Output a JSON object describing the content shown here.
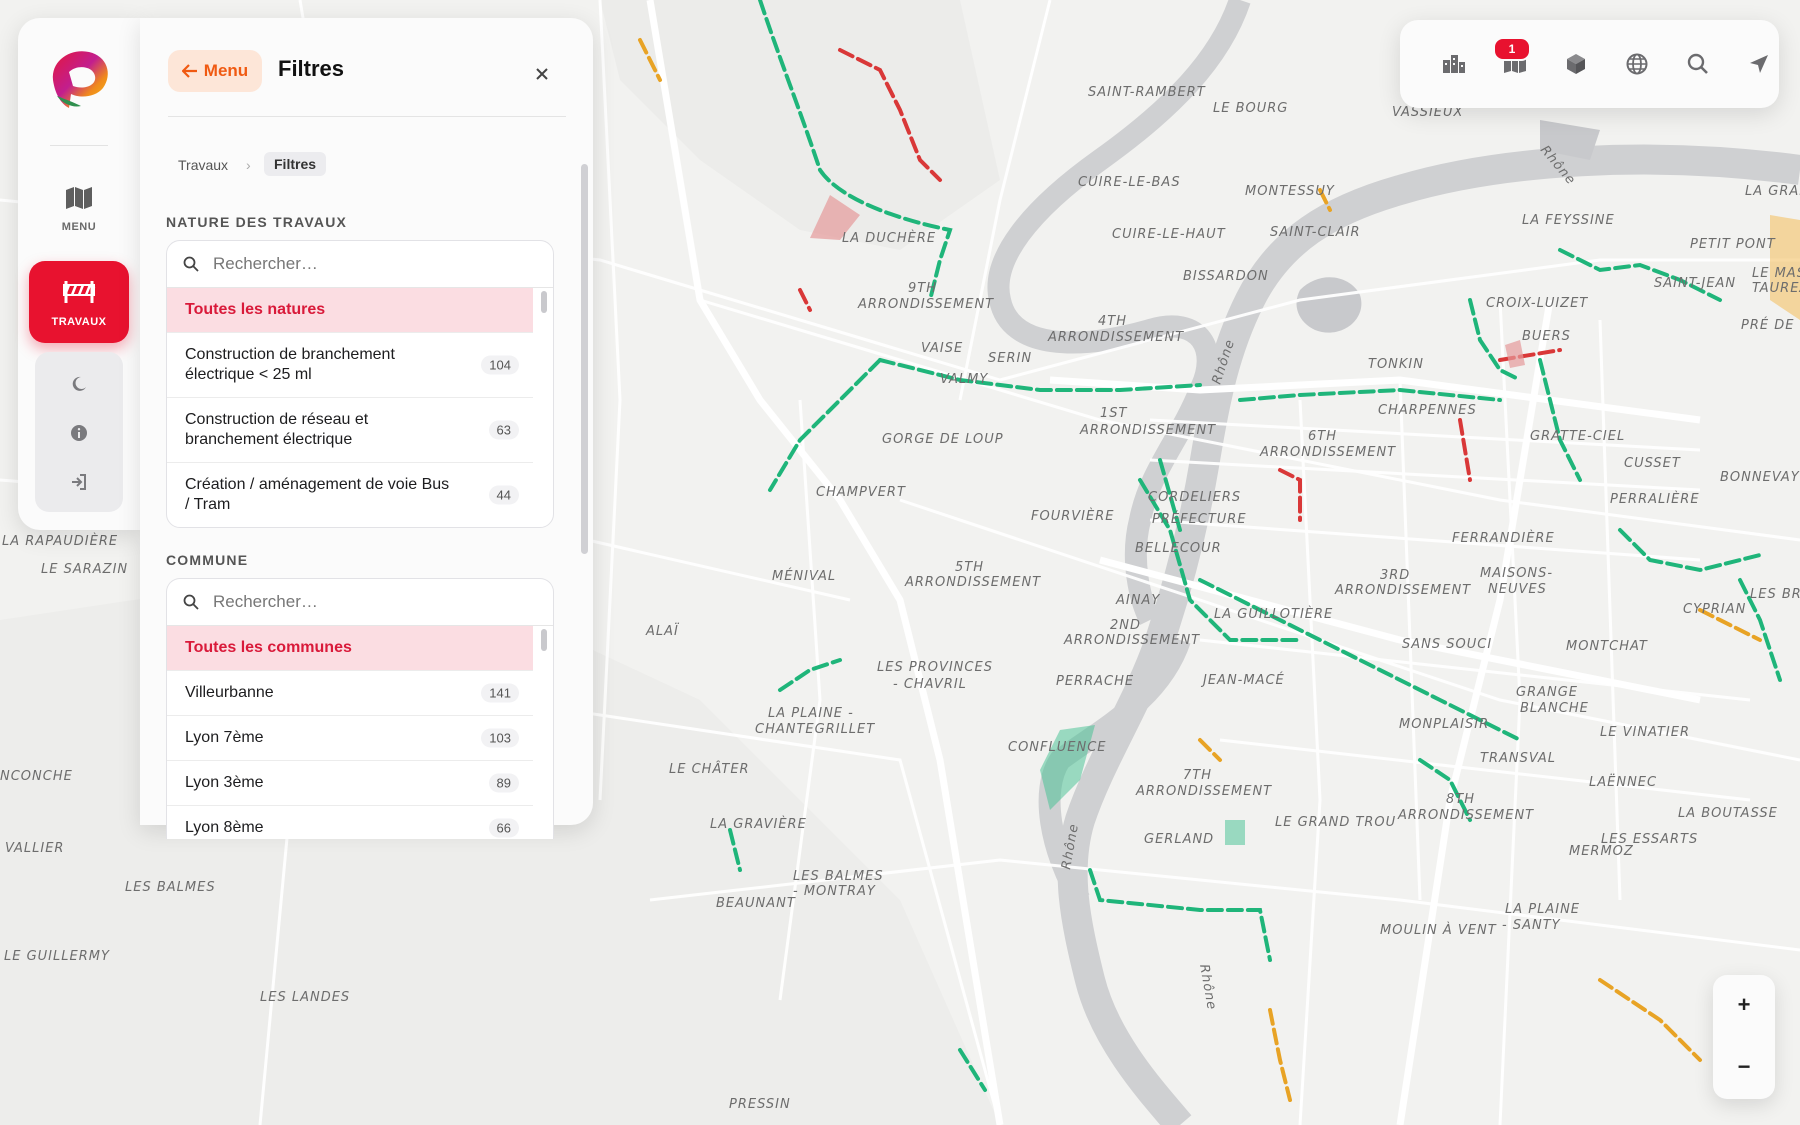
{
  "rail": {
    "menu_label": "MENU",
    "travaux_label": "TRAVAUX",
    "icons": {
      "menu": "map-icon",
      "travaux": "roadworks-barrier-icon",
      "theme": "moon-icon",
      "info": "info-icon",
      "login": "login-icon"
    }
  },
  "panel": {
    "back_label": "Menu",
    "title": "Filtres",
    "breadcrumb": [
      "Travaux",
      "Filtres"
    ],
    "nature": {
      "heading": "NATURE DES TRAVAUX",
      "search_placeholder": "Rechercher…",
      "selected": "Toutes les natures",
      "items": [
        {
          "label": "Construction de branchement électrique < 25 ml",
          "count": "104"
        },
        {
          "label": "Construction de réseau et branchement électrique",
          "count": "63"
        },
        {
          "label": "Création / aménagement de voie Bus / Tram",
          "count": "44"
        }
      ]
    },
    "commune": {
      "heading": "COMMUNE",
      "search_placeholder": "Rechercher…",
      "selected": "Toutes les communes",
      "items": [
        {
          "label": "Villeurbanne",
          "count": "141"
        },
        {
          "label": "Lyon 7ème",
          "count": "103"
        },
        {
          "label": "Lyon 3ème",
          "count": "89"
        },
        {
          "label": "Lyon 8ème",
          "count": "66"
        }
      ]
    }
  },
  "toolbar": {
    "badge": "1",
    "icons": [
      "buildings-icon",
      "map-layers-icon",
      "cube-3d-icon",
      "globe-icon",
      "search-icon",
      "locate-arrow-icon"
    ]
  },
  "zoom": {
    "in": "+",
    "out": "−"
  },
  "map": {
    "labels": [
      "SAINT-RAMBERT",
      "LE BOURG",
      "VASSIEUX",
      "CUIRE-LE-BAS",
      "MONTESSUY",
      "LA GRAF",
      "LA DUCHÈRE",
      "CUIRE-LE-HAUT",
      "SAINT-CLAIR",
      "LA FEYSSINE",
      "PETIT PONT",
      "9TH",
      "ARRONDISSEMENT",
      "BISSARDON",
      "CROIX-LUIZET",
      "SAINT-JEAN",
      "LE MAS DU",
      "TAUREAU",
      "4TH",
      "ARRONDISSEMENT",
      "BUERS",
      "PRÉ DE L",
      "VAISE",
      "SERIN",
      "TONKIN",
      "VALMY",
      "1ST",
      "ARRONDISSEMENT",
      "CHARPENNES",
      "GORGE DE LOUP",
      "6TH",
      "ARRONDISSEMENT",
      "GRATTE-CIEL",
      "CUSSET",
      "BONNEVAY",
      "CHAMPVERT",
      "CORDELIERS",
      "PERRALIÈRE",
      "FOURVIÈRE",
      "PRÉFECTURE",
      "FERRANDIÈRE",
      "BELLECOUR",
      "MÉNIVAL",
      "5TH",
      "ARRONDISSEMENT",
      "3RD",
      "ARRONDISSEMENT",
      "MAISONS-",
      "NEUVES",
      "AINAY",
      "CYPRIAN",
      "LES BRO",
      "ALAÏ",
      "2ND",
      "ARRONDISSEMENT",
      "LA GUILLOTIÈRE",
      "SANS SOUCI",
      "MONTCHAT",
      "LES PROVINCES",
      "- CHAVRIL",
      "PERRACHE",
      "JEAN-MACÉ",
      "GRANGE",
      "BLANCHE",
      "LA PLAINE -",
      "CHANTEGRILLET",
      "MONPLAISIR",
      "LE VINATIER",
      "CONFLUENCE",
      "TRANSVAL",
      "LE CHÂTER",
      "7TH",
      "ARRONDISSEMENT",
      "LAËNNEC",
      "8TH",
      "ARRONDISSEMENT",
      "LA BOUTASSE",
      "LA GRAVIÈRE",
      "GERLAND",
      "LE GRAND TROU",
      "MERMOZ",
      "LES ESSARTS",
      "LES BALMES",
      "- MONTRAY",
      "BEAUNANT",
      "MOULIN À VENT",
      "LA PLAINE",
      "- SANTY",
      "LA RAPAUDIÈRE",
      "LE SARAZIN",
      "NCONCHE",
      "VALLIER",
      "LES BALMES",
      "LE GUILLERMY",
      "LES LANDES",
      "PRESSIN",
      "Rhône",
      "Rhône",
      "Rhône",
      "Rhône"
    ]
  }
}
